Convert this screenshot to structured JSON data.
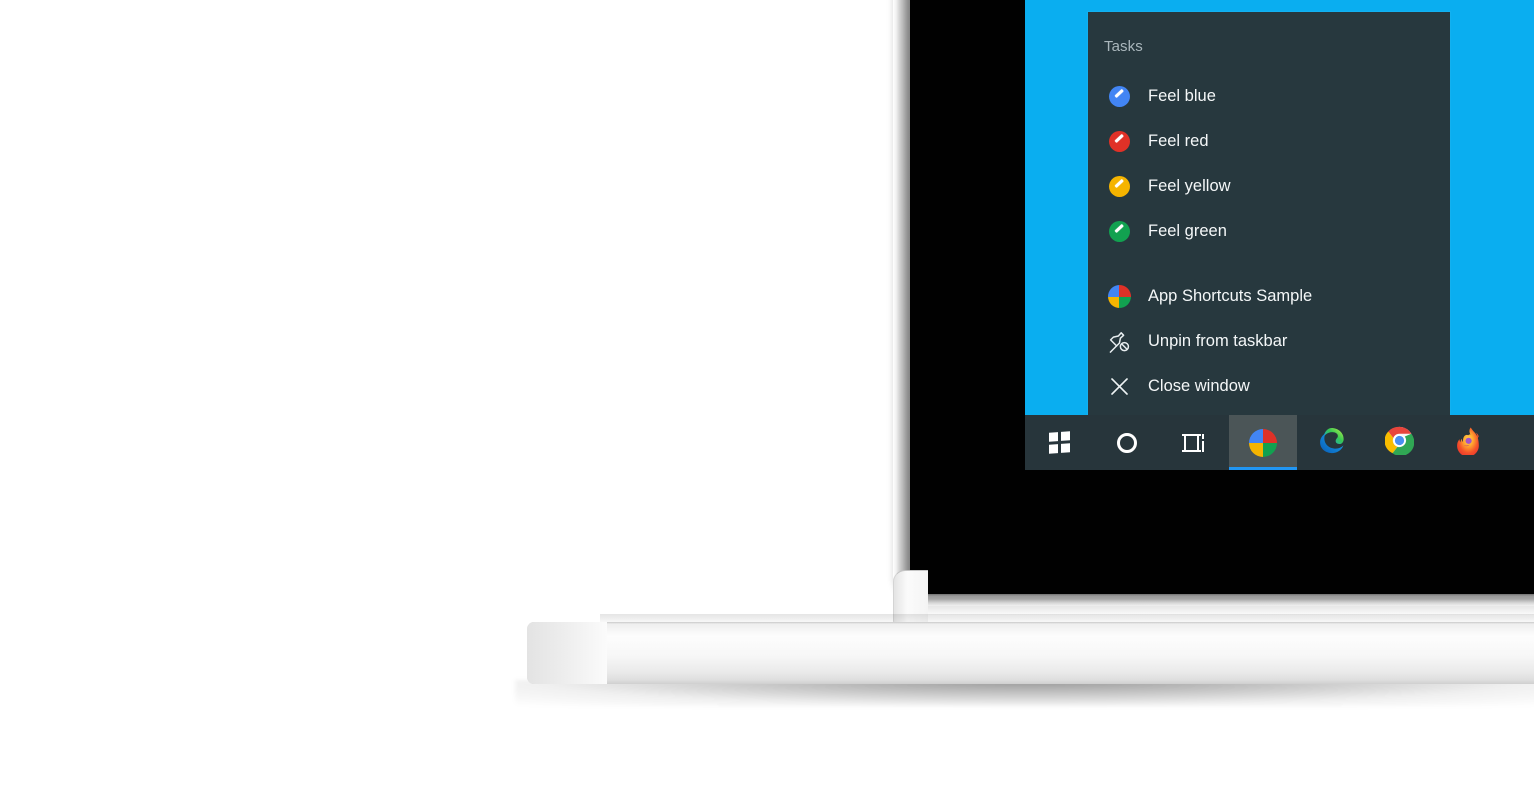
{
  "scene": {
    "device": "laptop-mockup",
    "background_color": "#ffffff"
  },
  "desktop": {
    "wallpaper_color": "#0aaef0"
  },
  "jumplist": {
    "background_color": "#27383e",
    "header": "Tasks",
    "tasks": [
      {
        "label": "Feel blue",
        "icon": "pencil-circle-icon",
        "color": "#4285f4"
      },
      {
        "label": "Feel red",
        "icon": "pencil-circle-icon",
        "color": "#e03127"
      },
      {
        "label": "Feel yellow",
        "icon": "pencil-circle-icon",
        "color": "#f5b400"
      },
      {
        "label": "Feel green",
        "icon": "pencil-circle-icon",
        "color": "#12a150"
      }
    ],
    "commands": [
      {
        "label": "App Shortcuts Sample",
        "icon": "app-quadrant-icon"
      },
      {
        "label": "Unpin from taskbar",
        "icon": "unpin-icon"
      },
      {
        "label": "Close window",
        "icon": "close-icon"
      }
    ]
  },
  "taskbar": {
    "background_color": "#27353b",
    "active_highlight_color": "#4b5557",
    "active_underline_color": "#2196f3",
    "buttons": [
      {
        "name": "start-button",
        "icon": "windows-logo-icon",
        "label": "Start",
        "active": false
      },
      {
        "name": "cortana-button",
        "icon": "cortana-circle-icon",
        "label": "Cortana",
        "active": false
      },
      {
        "name": "taskview-button",
        "icon": "task-view-icon",
        "label": "Task View",
        "active": false
      },
      {
        "name": "appshortcuts-button",
        "icon": "app-quadrant-icon",
        "label": "App Shortcuts Sample",
        "active": true
      },
      {
        "name": "edge-button",
        "icon": "edge-icon",
        "label": "Microsoft Edge",
        "active": false
      },
      {
        "name": "chrome-button",
        "icon": "chrome-icon",
        "label": "Google Chrome",
        "active": false
      },
      {
        "name": "firefox-button",
        "icon": "firefox-icon",
        "label": "Mozilla Firefox",
        "active": false
      }
    ]
  },
  "app_icon_colors": {
    "quadrant_top_left": "#4285f4",
    "quadrant_top_right": "#e03127",
    "quadrant_bottom_left": "#f5b400",
    "quadrant_bottom_right": "#12a150"
  }
}
